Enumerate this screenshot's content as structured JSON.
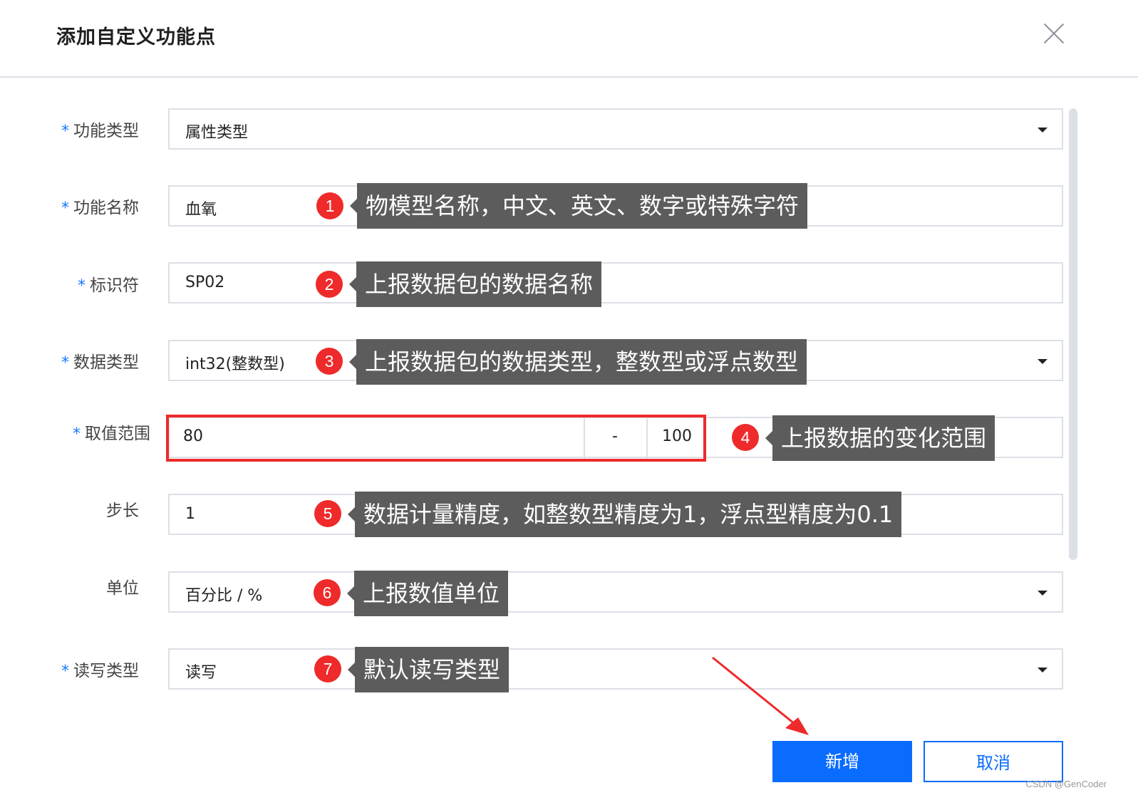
{
  "dialog": {
    "title": "添加自定义功能点",
    "close_icon": "close-icon"
  },
  "fields": {
    "func_type": {
      "label": "功能类型",
      "value": "属性类型"
    },
    "func_name": {
      "label": "功能名称",
      "value": "血氧"
    },
    "identifier": {
      "label": "标识符",
      "value": "SP02"
    },
    "data_type": {
      "label": "数据类型",
      "value": "int32(整数型)"
    },
    "range": {
      "label": "取值范围",
      "min": "80",
      "sep": "-",
      "max": "100"
    },
    "step": {
      "label": "步长",
      "value": "1"
    },
    "unit": {
      "label": "单位",
      "value": "百分比 / %"
    },
    "rw_type": {
      "label": "读写类型",
      "value": "读写"
    }
  },
  "required_mark": "*",
  "annotations": [
    {
      "num": "1",
      "text": "物模型名称，中文、英文、数字或特殊字符"
    },
    {
      "num": "2",
      "text": "上报数据包的数据名称"
    },
    {
      "num": "3",
      "text": "上报数据包的数据类型，整数型或浮点数型"
    },
    {
      "num": "4",
      "text": "上报数据的变化范围"
    },
    {
      "num": "5",
      "text": "数据计量精度，如整数型精度为1，浮点型精度为0.1"
    },
    {
      "num": "6",
      "text": "上报数值单位"
    },
    {
      "num": "7",
      "text": "默认读写类型"
    }
  ],
  "buttons": {
    "confirm": "新增",
    "cancel": "取消"
  },
  "watermark": "CSDN @GenCoder",
  "colors": {
    "primary": "#0a6cff",
    "annotation_red": "#ee2a2a",
    "tooltip_bg": "#5c5c5c"
  }
}
